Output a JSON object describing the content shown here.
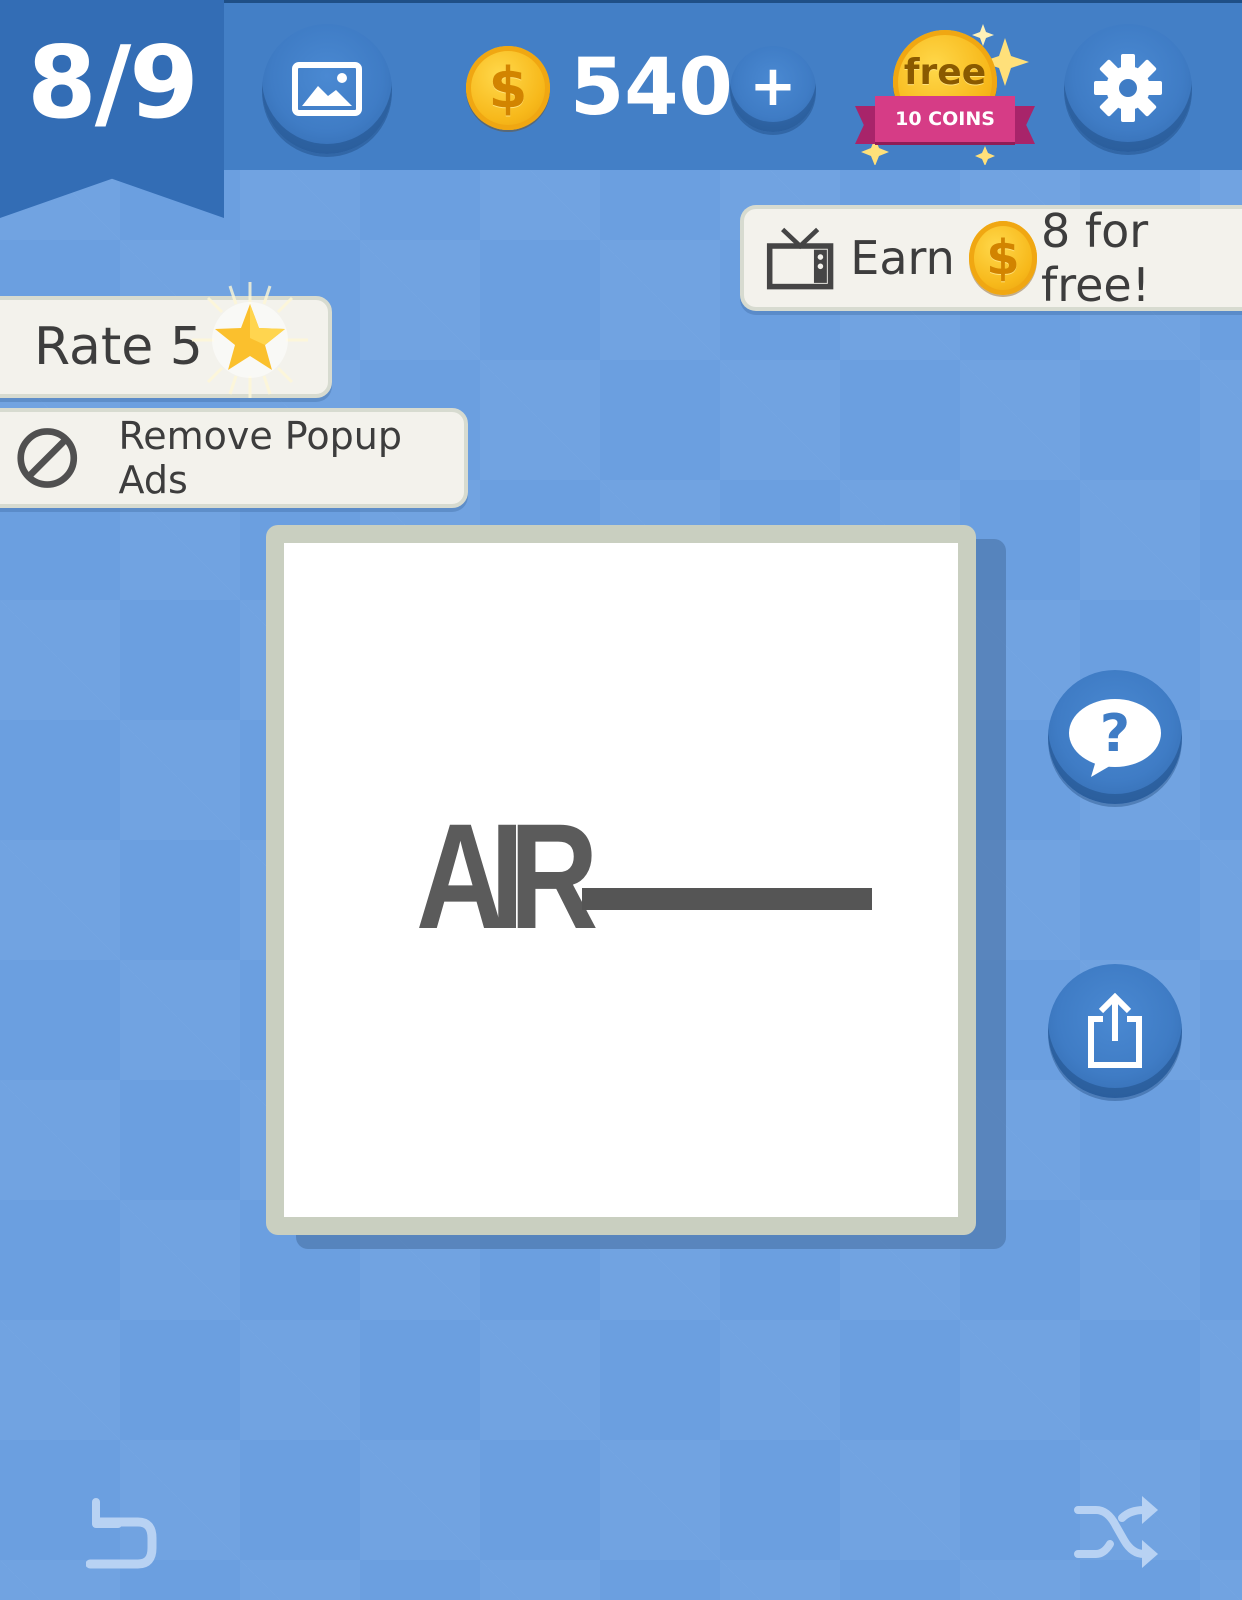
{
  "level": {
    "progress": "8/9"
  },
  "coins": {
    "count": "540",
    "add_symbol": "+",
    "coin_symbol": "$"
  },
  "free_coins": {
    "label": "free",
    "ribbon": "10 COINS"
  },
  "earn": {
    "prefix": "Earn",
    "suffix": "8 for free!"
  },
  "rate": {
    "label": "Rate 5"
  },
  "remove_ads": {
    "label": "Remove Popup Ads"
  },
  "puzzle": {
    "clue_text": "AIR"
  },
  "icons": {
    "gallery": "image-icon",
    "settings": "gear-icon",
    "tv": "tv-icon",
    "star": "star-icon",
    "no_ads": "no-ads-icon",
    "hint": "question-bubble-icon",
    "share": "share-icon",
    "undo": "undo-icon",
    "shuffle": "shuffle-icon"
  },
  "colors": {
    "background": "#6b9fe0",
    "topbar": "#437fc6",
    "button_blue": "#3f7cc5",
    "coin_gold": "#f7b81a",
    "ribbon_pink": "#d63c86",
    "pill_bg": "#f3f2ec"
  }
}
